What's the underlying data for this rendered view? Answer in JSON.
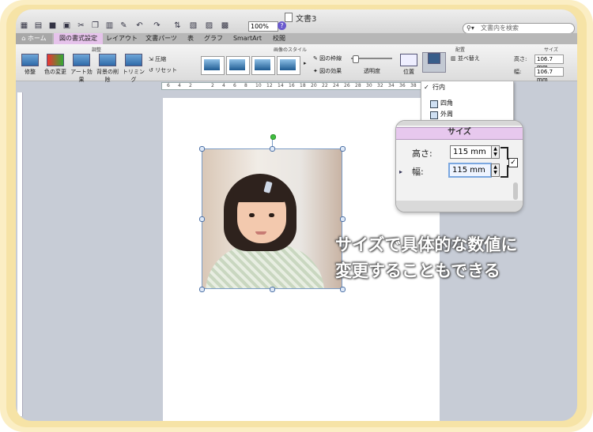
{
  "window": {
    "title": "文書3",
    "zoom": "100%",
    "search_placeholder": "文書内を検索",
    "help": "?"
  },
  "tabs": [
    {
      "label": "ホーム",
      "active": false
    },
    {
      "label": "図の書式設定",
      "active": true
    },
    {
      "label": "レイアウト",
      "active": false
    },
    {
      "label": "文書パーツ",
      "active": false
    },
    {
      "label": "表",
      "active": false
    },
    {
      "label": "グラフ",
      "active": false
    },
    {
      "label": "SmartArt",
      "active": false
    },
    {
      "label": "校閲",
      "active": false
    }
  ],
  "ribbon": {
    "group_adjust": "調整",
    "group_styles": "画像のスタイル",
    "group_arrange": "配置",
    "group_size": "サイズ",
    "adjust_items": [
      "修整",
      "色の変更",
      "アート効果",
      "背景の削除",
      "トリミング"
    ],
    "compress": "圧縮",
    "reset": "リセット",
    "picture_border": "図の枠線",
    "picture_effects": "図の効果",
    "transparency": "透明度",
    "position": "位置",
    "wrap_text": "文字列の折り返し",
    "reorder": "並べ替え",
    "height_label": "高さ:",
    "height_value": "106.7 mm",
    "width_label": "幅:",
    "width_value": "106.7 mm"
  },
  "ruler_numbers": [
    "6",
    "4",
    "2",
    "",
    "2",
    "4",
    "6",
    "8",
    "10",
    "12",
    "14",
    "16",
    "18",
    "20",
    "22",
    "24",
    "26",
    "28",
    "30",
    "32",
    "34",
    "36",
    "38"
  ],
  "wrap_menu": [
    {
      "label": "行内",
      "checked": true
    },
    {
      "label": "四角",
      "checked": false
    },
    {
      "label": "外周",
      "checked": false
    }
  ],
  "size_zoom": {
    "title": "サイズ",
    "height_label": "高さ:",
    "height_value": "115 mm",
    "width_label": "幅:",
    "width_value": "115 mm"
  },
  "annotation": {
    "line1": "サイズで具体的な数値に",
    "line2": "変更することもできる"
  },
  "colors": {
    "frame": "#f6e3a6",
    "active_tab": "#e6c3eb",
    "selection": "#7a9cc6"
  }
}
